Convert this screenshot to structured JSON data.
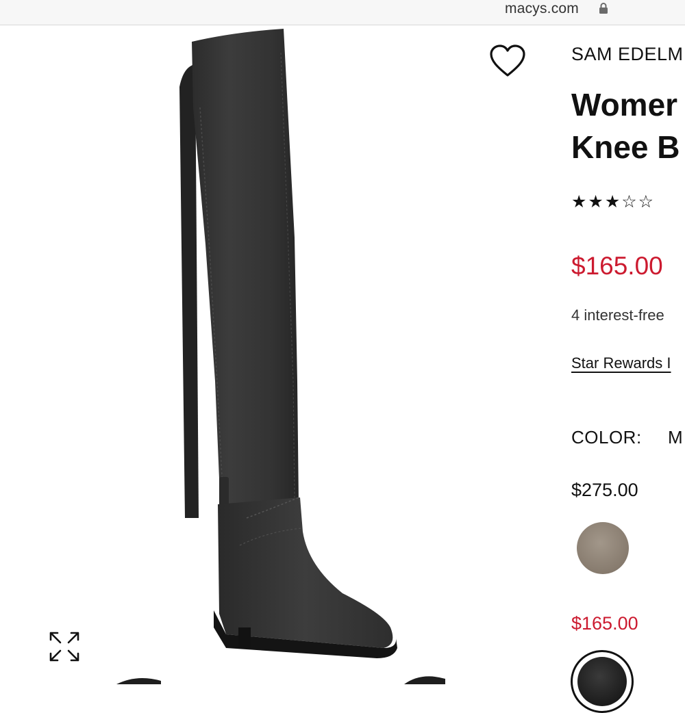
{
  "browser": {
    "url": "macys.com"
  },
  "product": {
    "brand": "SAM EDELM",
    "title_line1": "Womer",
    "title_line2": "Knee B",
    "rating_stars": "★★★☆☆",
    "rating_value": 3,
    "rating_max": 5,
    "price": "$165.00",
    "interest_text": "4 interest-free",
    "rewards_link": "Star Rewards I",
    "color_label": "COLOR:",
    "color_value": "M",
    "swatches": [
      {
        "price": "$275.00",
        "color": "#8a7f72",
        "price_color": "#111111"
      },
      {
        "price": "$165.00",
        "color": "#222222",
        "price_color": "#cc1a2f",
        "selected": true
      }
    ]
  },
  "icons": {
    "favorite": "heart-outline-icon",
    "expand": "expand-arrows-icon",
    "lock": "lock-icon"
  },
  "colors": {
    "sale_red": "#cc1a2f"
  }
}
